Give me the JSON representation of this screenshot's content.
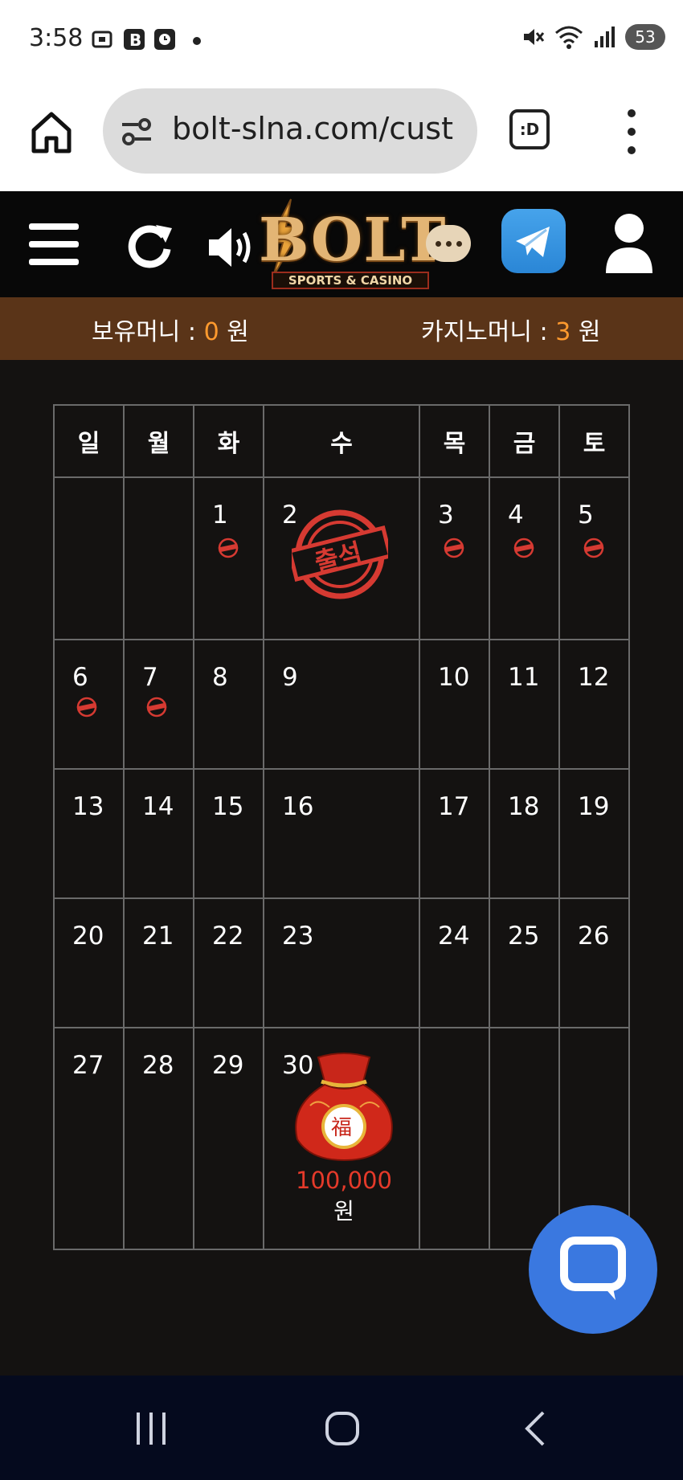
{
  "status_bar": {
    "time": "3:58",
    "battery": "53"
  },
  "browser": {
    "url": "bolt-slna.com/cust",
    "dex_label": ":D"
  },
  "site": {
    "logo_text": "BOLT",
    "logo_subtitle": "SPORTS & CASINO"
  },
  "money": {
    "hold_label": "보유머니 : ",
    "hold_value": "0",
    "hold_unit": " 원",
    "casino_label": "카지노머니 : ",
    "casino_value": "3",
    "casino_unit": " 원"
  },
  "calendar": {
    "weekdays": [
      "일",
      "월",
      "화",
      "수",
      "목",
      "금",
      "토"
    ],
    "stamp_text": "출석",
    "reward_amount": "100,000",
    "reward_unit": "원",
    "weeks": [
      [
        "",
        "",
        "1",
        "2",
        "3",
        "4",
        "5"
      ],
      [
        "6",
        "7",
        "8",
        "9",
        "10",
        "11",
        "12"
      ],
      [
        "13",
        "14",
        "15",
        "16",
        "17",
        "18",
        "19"
      ],
      [
        "20",
        "21",
        "22",
        "23",
        "24",
        "25",
        "26"
      ],
      [
        "27",
        "28",
        "29",
        "30",
        "",
        "",
        ""
      ]
    ],
    "attended_days": [
      "1",
      "2",
      "3",
      "4",
      "5",
      "6",
      "7"
    ]
  },
  "colors": {
    "accent_money": "#ff9a2e",
    "stamp_red": "#d63a32",
    "header_brown": "#5a3418",
    "reward_red": "#e53a2a"
  }
}
